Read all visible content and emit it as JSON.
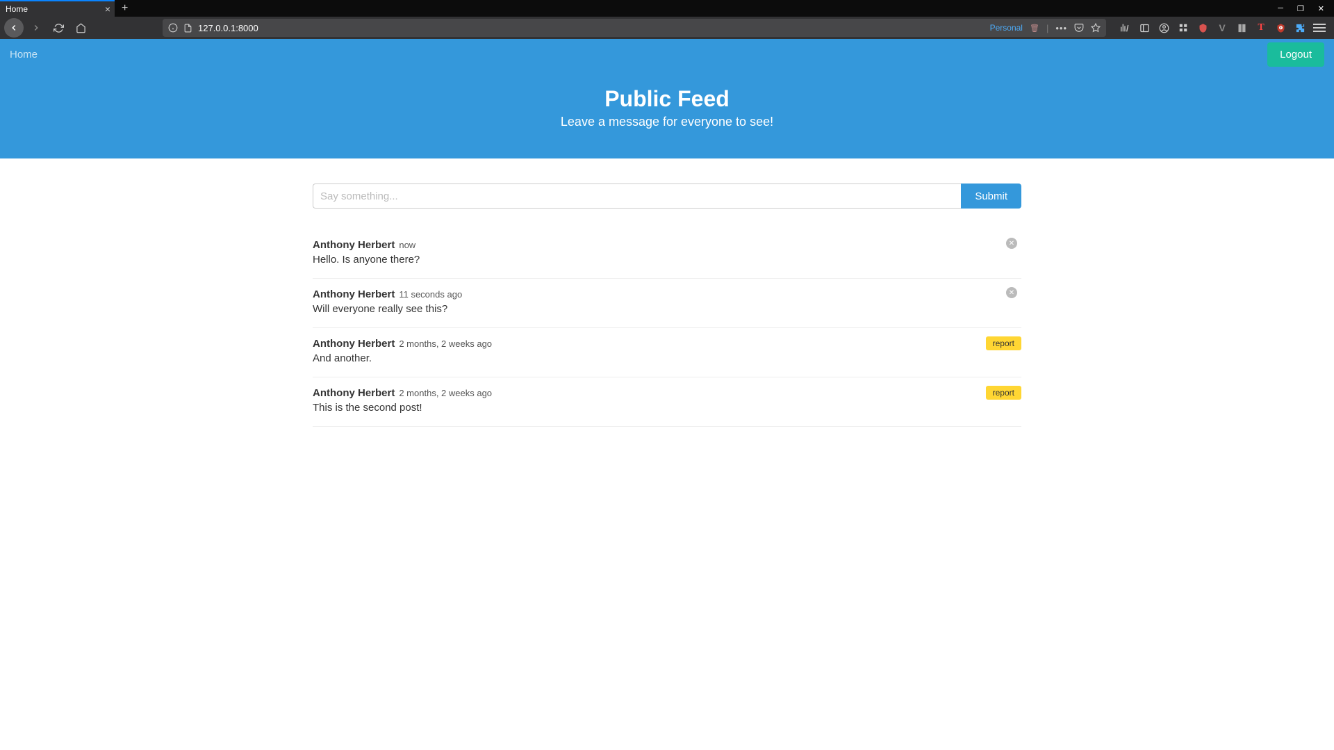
{
  "browser": {
    "tab_title": "Home",
    "url": "127.0.0.1:8000",
    "identity_label": "Personal"
  },
  "nav": {
    "home_label": "Home",
    "logout_label": "Logout"
  },
  "hero": {
    "title": "Public Feed",
    "subtitle": "Leave a message for everyone to see!"
  },
  "compose": {
    "placeholder": "Say something...",
    "submit_label": "Submit"
  },
  "posts": [
    {
      "author": "Anthony Herbert",
      "timestamp": "now",
      "content": "Hello. Is anyone there?",
      "action": "delete"
    },
    {
      "author": "Anthony Herbert",
      "timestamp": "11 seconds ago",
      "content": "Will everyone really see this?",
      "action": "delete"
    },
    {
      "author": "Anthony Herbert",
      "timestamp": "2 months, 2 weeks ago",
      "content": "And another.",
      "action": "report"
    },
    {
      "author": "Anthony Herbert",
      "timestamp": "2 months, 2 weeks ago",
      "content": "This is the second post!",
      "action": "report"
    }
  ],
  "labels": {
    "report": "report"
  }
}
